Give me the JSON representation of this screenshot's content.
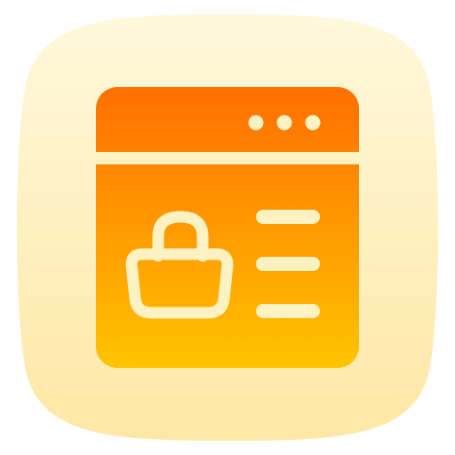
{
  "app_icon": {
    "icon": "online-shop-browser-icon",
    "colors": {
      "tile_top": "#fff8db",
      "tile_bottom": "#ffe8a6",
      "window_top": "#ff6f00",
      "window_bottom": "#ffc400",
      "line_color": "#fff2c2"
    },
    "window_dots": 3,
    "list_lines": 3
  }
}
